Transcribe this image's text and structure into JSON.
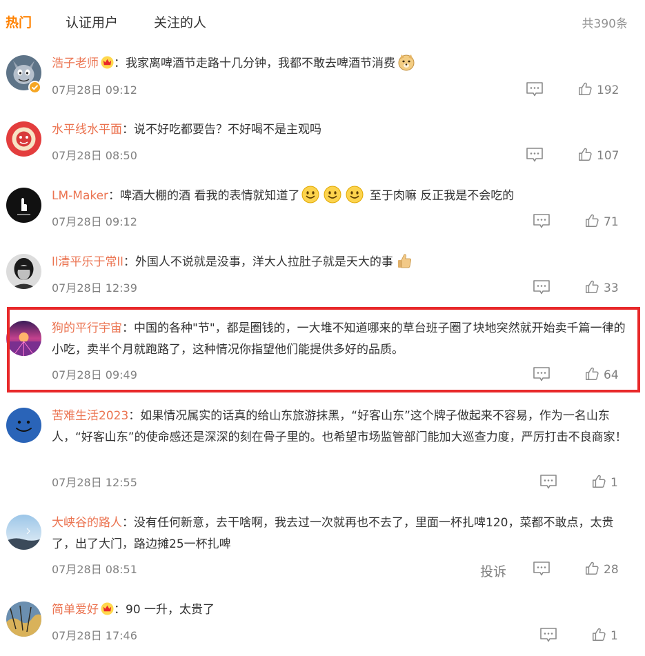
{
  "tabs": {
    "hot": "热门",
    "verified": "认证用户",
    "following": "关注的人"
  },
  "total_count": "共390条",
  "comments": [
    {
      "username": "浩子老师",
      "has_vip": true,
      "verified": true,
      "text": "我家离啤酒节走路十几分钟，我都不敢去啤酒节消费",
      "emoji": "doge-emoji",
      "time": "07月28日 09:12",
      "likes": "192"
    },
    {
      "username": "水平线水平面",
      "text": "说不好吃都要告？不好喝不是主观吗",
      "time": "07月28日 08:50",
      "likes": "107"
    },
    {
      "username": "LM-Maker",
      "text_a": "啤酒大棚的酒 看我的表情就知道了",
      "emoji": "smile-emoji",
      "text_b": "至于肉嘛 反正我是不会吃的",
      "time": "07月28日 09:12",
      "likes": "71"
    },
    {
      "username": "ll清平乐于常ll",
      "text": "外国人不说就是没事，洋大人拉肚子就是天大的事",
      "emoji": "thumbs-up-emoji",
      "time": "07月28日 12:39",
      "likes": "33"
    },
    {
      "username": "狗的平行宇宙",
      "text": "中国的各种\"节\"，都是圈钱的，一大堆不知道哪来的草台班子圈了块地突然就开始卖千篇一律的小吃，卖半个月就跑路了，这种情况你指望他们能提供多好的品质。",
      "time": "07月28日 09:49",
      "likes": "64",
      "highlighted": true
    },
    {
      "username": "苦难生活2023",
      "text": "如果情况属实的话真的给山东旅游抹黑，“好客山东”这个牌子做起来不容易，作为一名山东人，“好客山东”的使命感还是深深的刻在骨子里的。也希望市场监管部门能加大巡查力度，严厉打击不良商家！",
      "time": "07月28日 12:55",
      "likes": "1"
    },
    {
      "username": "大峡谷的路人",
      "text": "没有任何新意，去干啥啊，我去过一次就再也不去了，里面一杯扎啤120，菜都不敢点，太贵了，出了大门，路边摊25一杯扎啤",
      "time": "07月28日 08:51",
      "likes": "28",
      "report_label": "投诉"
    },
    {
      "username": "简单爱好",
      "has_vip": true,
      "text": "90 一升，太贵了",
      "time": "07月28日 17:46",
      "likes": "1"
    }
  ],
  "colors": {
    "accent": "#ff8200",
    "username": "#eb7350",
    "highlight_border": "#e8292a",
    "meta_text": "#808080"
  }
}
